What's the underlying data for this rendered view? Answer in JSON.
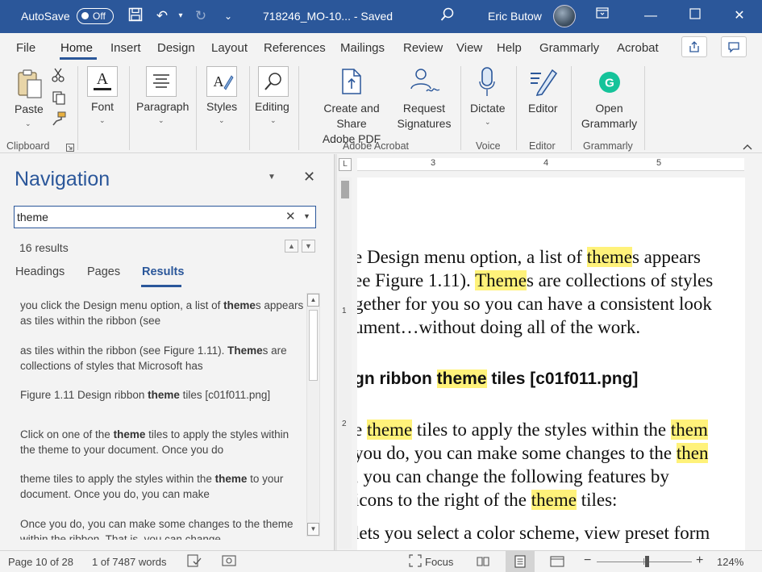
{
  "titlebar": {
    "autosave_label": "AutoSave",
    "autosave_state": "Off",
    "document_title": "718246_MO-10... - Saved",
    "user_name": "Eric Butow"
  },
  "ribbon_tabs": [
    "File",
    "Home",
    "Insert",
    "Design",
    "Layout",
    "References",
    "Mailings",
    "Review",
    "View",
    "Help",
    "Grammarly",
    "Acrobat"
  ],
  "active_tab": "Home",
  "ribbon": {
    "paste": "Paste",
    "font": "Font",
    "paragraph": "Paragraph",
    "styles": "Styles",
    "editing": "Editing",
    "create_share_line1": "Create and Share",
    "create_share_line2": "Adobe PDF",
    "request_line1": "Request",
    "request_line2": "Signatures",
    "dictate": "Dictate",
    "editor": "Editor",
    "open_grammarly_line1": "Open",
    "open_grammarly_line2": "Grammarly",
    "groups": {
      "clipboard": "Clipboard",
      "adobe_acrobat": "Adobe Acrobat",
      "voice": "Voice",
      "editor": "Editor",
      "grammarly": "Grammarly"
    }
  },
  "navigation": {
    "title": "Navigation",
    "search_value": "theme",
    "results_count": "16 results",
    "tabs": [
      "Headings",
      "Pages",
      "Results"
    ],
    "active_tab": "Results",
    "results": [
      {
        "before": "you click the Design menu option, a list of ",
        "match": "theme",
        "after": "s appears as tiles within the ribbon (see"
      },
      {
        "before": "as tiles within the ribbon (see Figure 1.11). ",
        "match": "Theme",
        "after": "s are collections of styles that Microsoft has"
      },
      {
        "before": "Figure 1.11 Design ribbon ",
        "match": "theme",
        "after": " tiles [c01f011.png]"
      },
      {
        "before": "Click on one of the ",
        "match": "theme",
        "after": " tiles to apply the styles within the theme to your document. Once you do"
      },
      {
        "before": "theme tiles to apply the styles within the ",
        "match": "theme",
        "after": " to your document. Once you do, you can make"
      },
      {
        "before": "Once you do, you can make some changes to the ",
        "match": "",
        "after": "theme within the ribbon. That is, you can change"
      }
    ]
  },
  "document": {
    "lines": [
      {
        "parts": [
          "e Design menu option, a list of ",
          "theme",
          "s appears"
        ]
      },
      {
        "parts": [
          "ee Figure 1.11). ",
          "Theme",
          "s are collections of styles"
        ]
      },
      {
        "parts": [
          "gether for you so you can have a consistent look"
        ]
      },
      {
        "parts": [
          "ument…without doing all of the work."
        ]
      },
      {
        "parts": [
          "gn ribbon ",
          "theme",
          " tiles [c01f011.png]"
        ]
      },
      {
        "parts": [
          "e ",
          "theme",
          " tiles to apply the styles within the ",
          "them"
        ]
      },
      {
        "parts": [
          "you do, you can make some changes to the ",
          "then"
        ]
      },
      {
        "parts": [
          ", you can change the following features by"
        ]
      },
      {
        "parts": [
          " icons to the right of the ",
          "theme",
          " tiles:"
        ]
      },
      {
        "parts": [
          "lets you select a color scheme, view preset form"
        ]
      }
    ]
  },
  "ruler": {
    "top_numbers": [
      "3",
      "4",
      "5"
    ],
    "left_numbers": [
      "1",
      "2"
    ]
  },
  "statusbar": {
    "page": "Page 10 of 28",
    "words": "1 of 7487 words",
    "focus": "Focus",
    "zoom": "124%"
  },
  "colors": {
    "accent": "#2b579a",
    "highlight": "#fff27a",
    "grammarly": "#15c39a"
  }
}
